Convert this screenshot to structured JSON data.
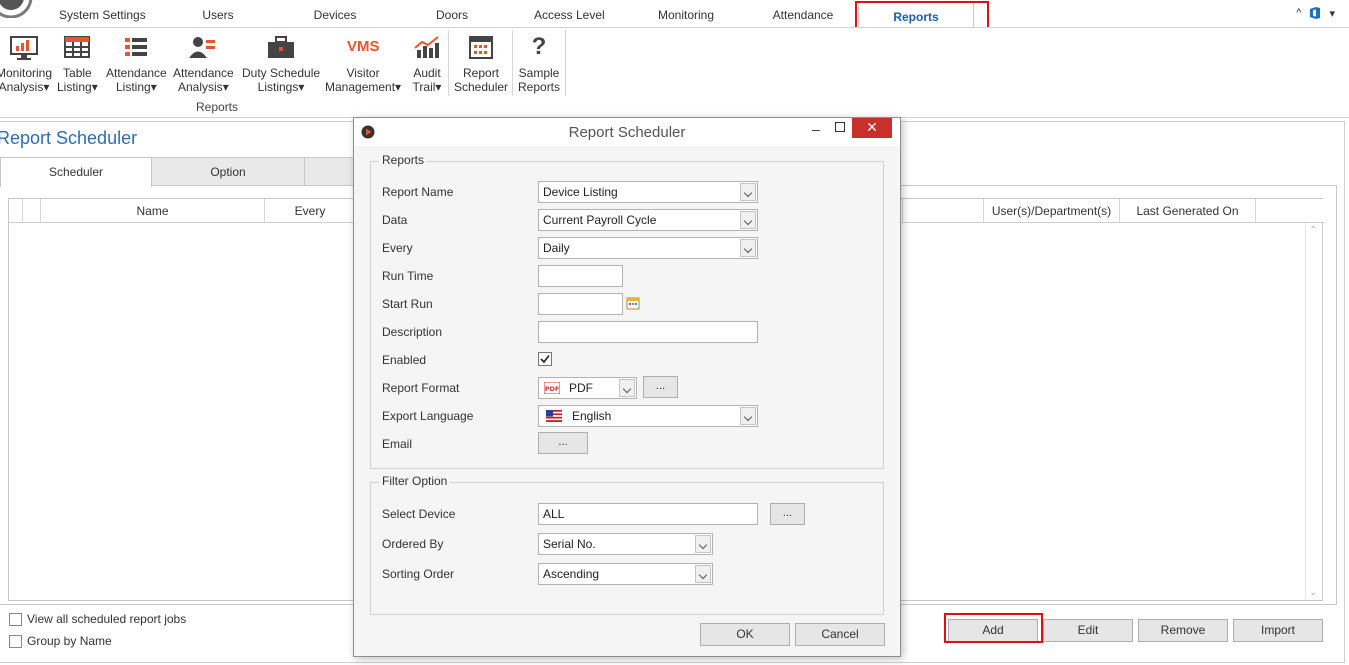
{
  "menu": {
    "tabs": [
      "System Settings",
      "Users",
      "Devices",
      "Doors",
      "Access Level",
      "Monitoring",
      "Attendance",
      "Reports"
    ],
    "active": "Reports"
  },
  "ribbon": {
    "buttons": [
      {
        "line1": "Monitoring",
        "line2": "Analysis",
        "icon": "monitor-chart-icon"
      },
      {
        "line1": "Table",
        "line2": "Listing",
        "icon": "table-grid-icon"
      },
      {
        "line1": "Attendance",
        "line2": "Listing",
        "icon": "list-icon"
      },
      {
        "line1": "Attendance",
        "line2": "Analysis",
        "icon": "user-list-icon"
      },
      {
        "line1": "Duty Schedule",
        "line2": "Listings",
        "icon": "briefcase-icon"
      },
      {
        "line1": "Visitor",
        "line2": "Management",
        "icon": "vms-icon",
        "icon_text": "VMS"
      },
      {
        "line1": "Audit",
        "line2": "Trail",
        "icon": "line-chart-icon"
      },
      {
        "line1": "Report",
        "line2": "Scheduler",
        "icon": "calendar-icon"
      },
      {
        "line1": "Sample",
        "line2": "Reports",
        "icon": "question-icon",
        "icon_text": "?"
      }
    ],
    "dropdown_marker": "▾",
    "group_label": "Reports"
  },
  "page": {
    "title": "Report Scheduler",
    "tabs": [
      "Scheduler",
      "Option"
    ],
    "grid_columns": [
      "Name",
      "Every",
      "User(s)/Department(s)",
      "Last Generated On"
    ],
    "checkboxes": [
      "View all scheduled report jobs",
      "Group by Name"
    ],
    "buttons": {
      "add": "Add",
      "edit": "Edit",
      "remove": "Remove",
      "import": "Import"
    }
  },
  "dialog": {
    "title": "Report Scheduler",
    "reports_legend": "Reports",
    "labels": {
      "report_name": "Report Name",
      "data": "Data",
      "every": "Every",
      "run_time": "Run Time",
      "start_run": "Start Run",
      "description": "Description",
      "enabled": "Enabled",
      "report_format": "Report Format",
      "export_language": "Export Language",
      "email": "Email"
    },
    "values": {
      "report_name": "Device Listing",
      "data": "Current Payroll Cycle",
      "every": "Daily",
      "run_time": "",
      "start_run": "",
      "description": "",
      "report_format": "PDF",
      "export_language": "English"
    },
    "enabled_checked": true,
    "ellipsis": "...",
    "filter_legend": "Filter Option",
    "filter_labels": {
      "select_device": "Select Device",
      "ordered_by": "Ordered By",
      "sorting_order": "Sorting Order"
    },
    "filter_values": {
      "select_device": "ALL",
      "ordered_by": "Serial No.",
      "sorting_order": "Ascending"
    },
    "ok": "OK",
    "cancel": "Cancel"
  },
  "colors": {
    "accent_blue": "#2e6db4",
    "ribbon_orange": "#e8542b",
    "highlight_red": "#e01010",
    "close_red": "#c7302b"
  }
}
